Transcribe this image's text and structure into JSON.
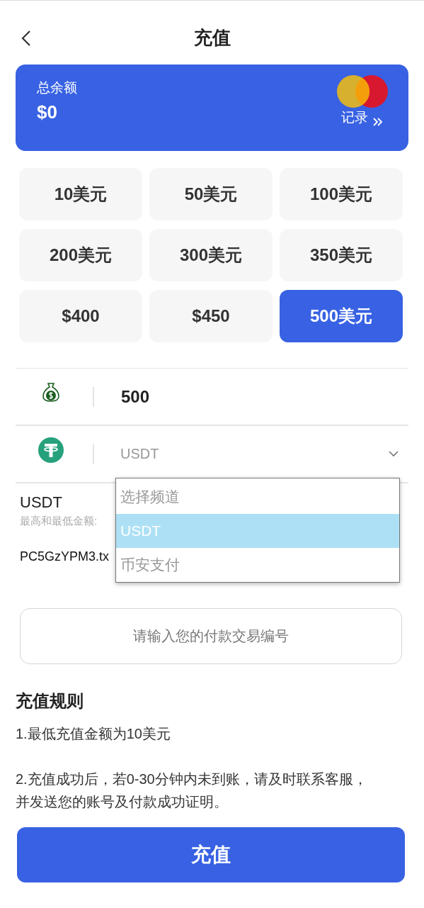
{
  "header": {
    "title": "充值"
  },
  "balance_card": {
    "label": "总余额",
    "amount": "$0",
    "records_link": "记录"
  },
  "amounts": [
    {
      "label": "10美元",
      "selected": false
    },
    {
      "label": "50美元",
      "selected": false
    },
    {
      "label": "100美元",
      "selected": false
    },
    {
      "label": "200美元",
      "selected": false
    },
    {
      "label": "300美元",
      "selected": false
    },
    {
      "label": "350美元",
      "selected": false
    },
    {
      "label": "$400",
      "selected": false
    },
    {
      "label": "$450",
      "selected": false
    },
    {
      "label": "500美元",
      "selected": true
    }
  ],
  "amount_row": {
    "value": "500"
  },
  "channel_select": {
    "value": "USDT",
    "expanded": true,
    "options": [
      {
        "label": "选择频道",
        "selected": false
      },
      {
        "label": "USDT",
        "selected": true
      },
      {
        "label": "币安支付",
        "selected": false
      }
    ]
  },
  "channel_info": {
    "name": "USDT",
    "limits": "最高和最低金额:",
    "address": "PC5GzYPM3.tx"
  },
  "txid_field": {
    "placeholder": "请输入您的付款交易编号"
  },
  "rules": {
    "title": "充值规则",
    "items": [
      "1.最低充值金额为10美元",
      "2.充值成功后，若0-30分钟内未到账，请及时联系客服，并发送您的账号及付款成功证明。"
    ]
  },
  "submit_button": "充值"
}
